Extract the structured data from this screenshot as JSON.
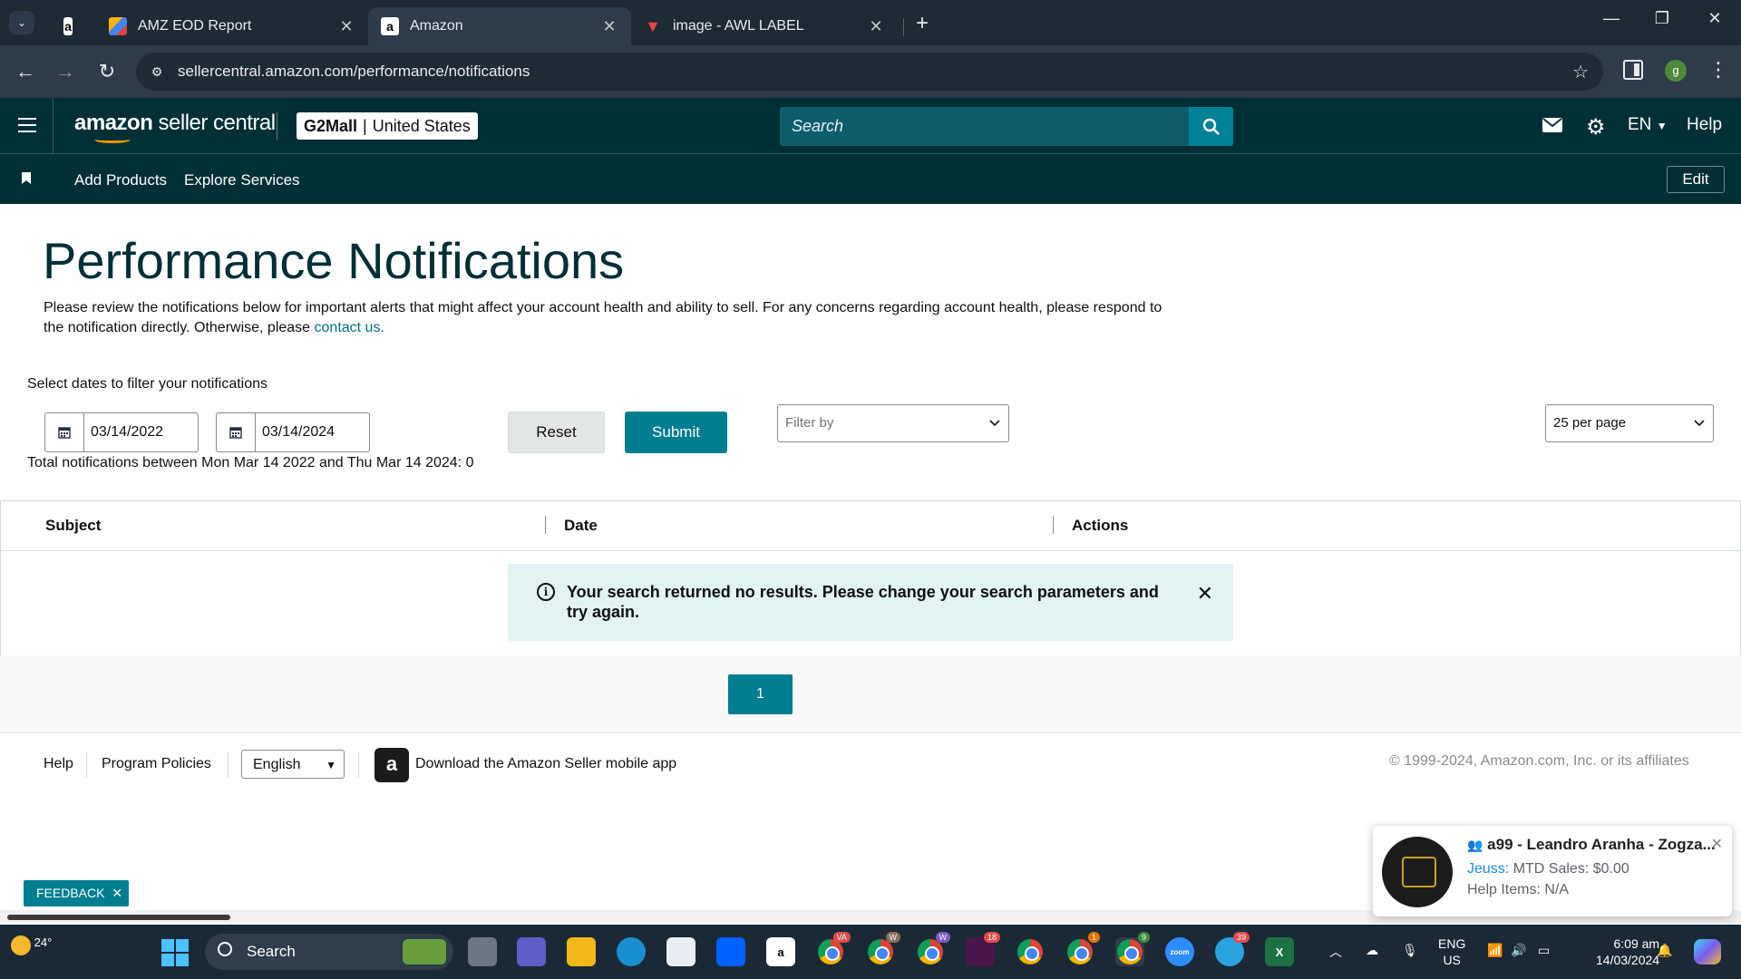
{
  "browser": {
    "tabs": [
      {
        "label": "AMZ EOD Report",
        "icon": "docs-pencil-icon"
      },
      {
        "label": "Amazon",
        "icon": "amazon-icon",
        "active": true
      },
      {
        "label": "image - AWL LABEL",
        "icon": "label-icon"
      }
    ],
    "url": "sellercentral.amazon.com/performance/notifications",
    "profile_initial": "g"
  },
  "header": {
    "logo_brand": "amazon",
    "logo_product": "seller central",
    "store_name": "G2Mall",
    "store_sep": "|",
    "store_region": "United States",
    "search_placeholder": "Search",
    "language": "EN",
    "help": "Help"
  },
  "subnav": {
    "items": [
      "Add Products",
      "Explore Services"
    ],
    "edit": "Edit"
  },
  "main": {
    "title": "Performance Notifications",
    "intro": "Please review the notifications below for important alerts that might affect your account health and ability to sell. For any concerns regarding account health, please respond to the notification directly. Otherwise, please ",
    "intro_link": "contact us.",
    "filter_label": "Select dates to filter your notifications",
    "date_from": "03/14/2022",
    "date_to": "03/14/2024",
    "reset": "Reset",
    "submit": "Submit",
    "filter_by": "Filter by",
    "per_page": "25 per page",
    "total": "Total notifications between Mon Mar 14 2022 and Thu Mar 14 2024: 0",
    "columns": [
      "Subject",
      "Date",
      "Actions"
    ],
    "alert": "Your search returned no results. Please change your search parameters and try again.",
    "page": "1"
  },
  "footer": {
    "help": "Help",
    "policies": "Program Policies",
    "language": "English",
    "app_text": "Download the Amazon Seller mobile app",
    "copyright": "© 1999-2024, Amazon.com, Inc. or its affiliates"
  },
  "feedback": {
    "label": "FEEDBACK",
    "close": "✕"
  },
  "toast": {
    "title": "a99 - Leandro Aranha - Zogza...",
    "sender": "Jeuss:",
    "line1": " MTD Sales: $0.00",
    "line2": "Help Items: N/A"
  },
  "taskbar": {
    "temp": "24°",
    "search": "Search",
    "badges": {
      "chrome_va": "VA",
      "chrome_w1": "W",
      "chrome_w2": "W",
      "slack": "18",
      "chrome_1": "1",
      "chrome_9": "9",
      "telegram": "39"
    },
    "lang_top": "ENG",
    "lang_bottom": "US",
    "time": "6:09 am",
    "date": "14/03/2024"
  },
  "colors": {
    "header_bg": "#002f36",
    "accent": "#007e8f",
    "link": "#007185",
    "alert_bg": "#e3f2f2"
  }
}
